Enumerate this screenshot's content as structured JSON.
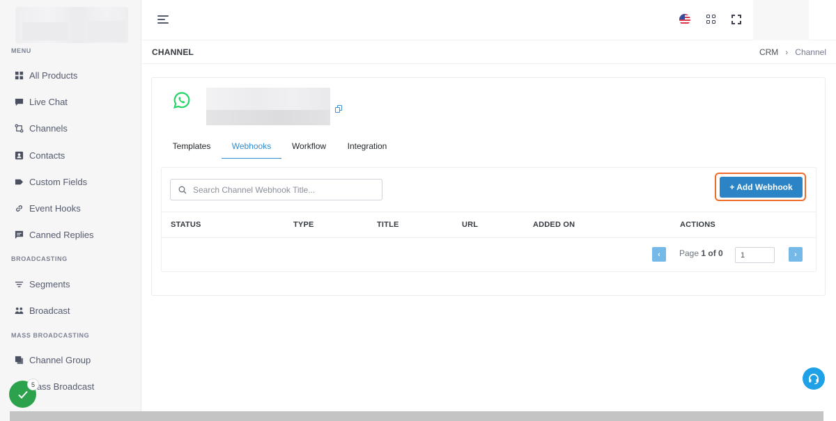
{
  "sidebar": {
    "sections": [
      {
        "heading": "MENU",
        "items": [
          {
            "label": "All Products",
            "icon": "grid-icon"
          },
          {
            "label": "Live Chat",
            "icon": "chat-icon"
          },
          {
            "label": "Channels",
            "icon": "channels-icon"
          },
          {
            "label": "Contacts",
            "icon": "contacts-icon"
          },
          {
            "label": "Custom Fields",
            "icon": "tag-icon"
          },
          {
            "label": "Event Hooks",
            "icon": "link-icon"
          },
          {
            "label": "Canned Replies",
            "icon": "message-icon"
          }
        ]
      },
      {
        "heading": "BROADCASTING",
        "items": [
          {
            "label": "Segments",
            "icon": "filter-icon"
          },
          {
            "label": "Broadcast",
            "icon": "users-icon"
          }
        ]
      },
      {
        "heading": "MASS BROADCASTING",
        "items": [
          {
            "label": "Channel Group",
            "icon": "copy-icon"
          },
          {
            "label": "Mass Broadcast",
            "icon": "broadcast-icon"
          }
        ]
      }
    ]
  },
  "header": {
    "page_title": "CHANNEL",
    "breadcrumb": [
      "CRM",
      "Channel"
    ],
    "language_icon": "us-flag-icon"
  },
  "channel": {
    "icon": "whatsapp-icon"
  },
  "tabs": [
    {
      "label": "Templates",
      "active": false
    },
    {
      "label": "Webhooks",
      "active": true
    },
    {
      "label": "Workflow",
      "active": false
    },
    {
      "label": "Integration",
      "active": false
    }
  ],
  "toolbar": {
    "search_placeholder": "Search Channel Webhook Title...",
    "add_button": "+ Add Webhook"
  },
  "table": {
    "columns": [
      "STATUS",
      "TYPE",
      "TITLE",
      "URL",
      "ADDED ON",
      "ACTIONS"
    ],
    "rows": []
  },
  "pagination": {
    "prev": "‹",
    "next": "›",
    "page_label": "Page",
    "page_info": "1 of 0",
    "input_value": "1"
  },
  "widgets": {
    "notification_count": "5"
  },
  "colors": {
    "primary": "#2a84c5",
    "highlight_border": "#f06a2a",
    "whatsapp": "#25d366",
    "success": "#2ca24c"
  }
}
